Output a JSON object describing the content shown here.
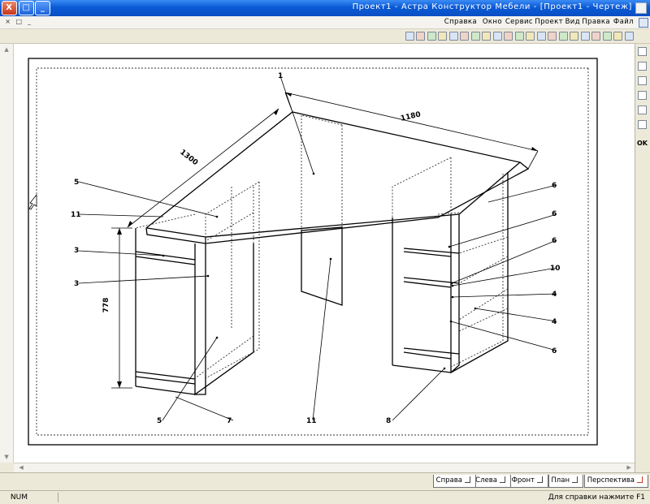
{
  "window": {
    "title": "Проект1 - Астра Конструктор Мебели - [Проект1 - Чертеж]",
    "minimize": "_",
    "maximize": "□",
    "close": "X"
  },
  "menu": {
    "items": [
      {
        "label": "Файл",
        "name": "menu-file"
      },
      {
        "label": "Правка",
        "name": "menu-edit"
      },
      {
        "label": "Вид",
        "name": "menu-view"
      },
      {
        "label": "Проект",
        "name": "menu-project"
      },
      {
        "label": "Сервис",
        "name": "menu-service"
      },
      {
        "label": "Окно",
        "name": "menu-window"
      },
      {
        "label": "Справка",
        "name": "menu-help"
      }
    ],
    "mdi_controls": [
      "_",
      "□",
      "×"
    ]
  },
  "toolbar": {
    "icons": [
      "new-file-icon",
      "open-icon",
      "save-icon",
      "print-icon",
      "cut-icon",
      "copy-icon",
      "paste-icon",
      "undo-icon",
      "redo-icon",
      "zoom-in-icon",
      "zoom-out-icon",
      "zoom-fit-icon",
      "pan-icon",
      "rotate-icon",
      "select-icon",
      "cabinet-icon",
      "shelf-icon",
      "panel-icon",
      "door-icon",
      "drawer-icon",
      "settings-icon"
    ]
  },
  "sidebar": {
    "label": "OK"
  },
  "drawing": {
    "dimensions": {
      "top_width": "1180",
      "side_width": "1300",
      "height": "778"
    },
    "part_labels": {
      "top": "1",
      "left_1": "6",
      "left_2": "6",
      "left_3": "6",
      "left_4": "10",
      "left_5": "4",
      "left_6": "4",
      "left_7": "6",
      "right_1": "5",
      "right_2": "11",
      "right_3": "3",
      "right_4": "3",
      "bottom_1": "8",
      "bottom_2": "11",
      "bottom_3": "7",
      "bottom_4": "5"
    }
  },
  "tabs": [
    {
      "label": "Перспектива",
      "name": "tab-perspective"
    },
    {
      "label": "План",
      "name": "tab-plan"
    },
    {
      "label": "Фронт",
      "name": "tab-front"
    },
    {
      "label": "Слева",
      "name": "tab-left"
    },
    {
      "label": "Справа",
      "name": "tab-right"
    }
  ],
  "status": {
    "help": "Для справки нажмите F1",
    "num": "NUM"
  },
  "colors": {
    "titlebar": "#0a5ad6",
    "close_button": "#c8361e",
    "window_bg": "#ece9d8",
    "canvas": "#ffffff"
  }
}
